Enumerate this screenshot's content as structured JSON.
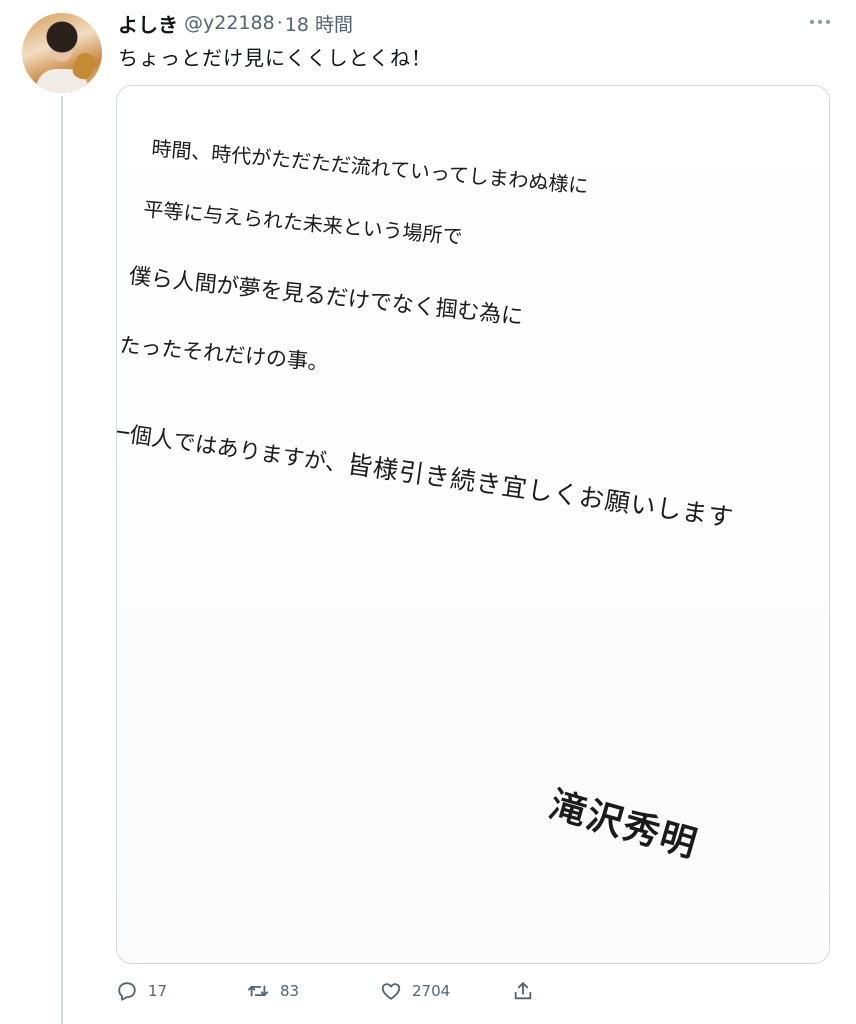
{
  "tweet": {
    "display_name": "よしき",
    "handle": "@y22188",
    "separator": "·",
    "time": "18 時間",
    "text": "ちょっとだけ見にくくしとくね！"
  },
  "media": {
    "lines": [
      "時間、時代がただただ流れていってしまわぬ様に",
      "平等に与えられた未来という場所で",
      "僕ら人間が夢を見るだけでなく掴む為に",
      "たったそれだけの事。",
      "一個人ではありますが、",
      "皆様引き続き宜しくお願いします"
    ],
    "signature": "滝沢秀明"
  },
  "actions": {
    "reply_count": "17",
    "retweet_count": "83",
    "like_count": "2704"
  },
  "icons": {
    "more": "more-icon",
    "reply": "reply-icon",
    "retweet": "retweet-icon",
    "like": "like-icon",
    "share": "share-icon"
  }
}
